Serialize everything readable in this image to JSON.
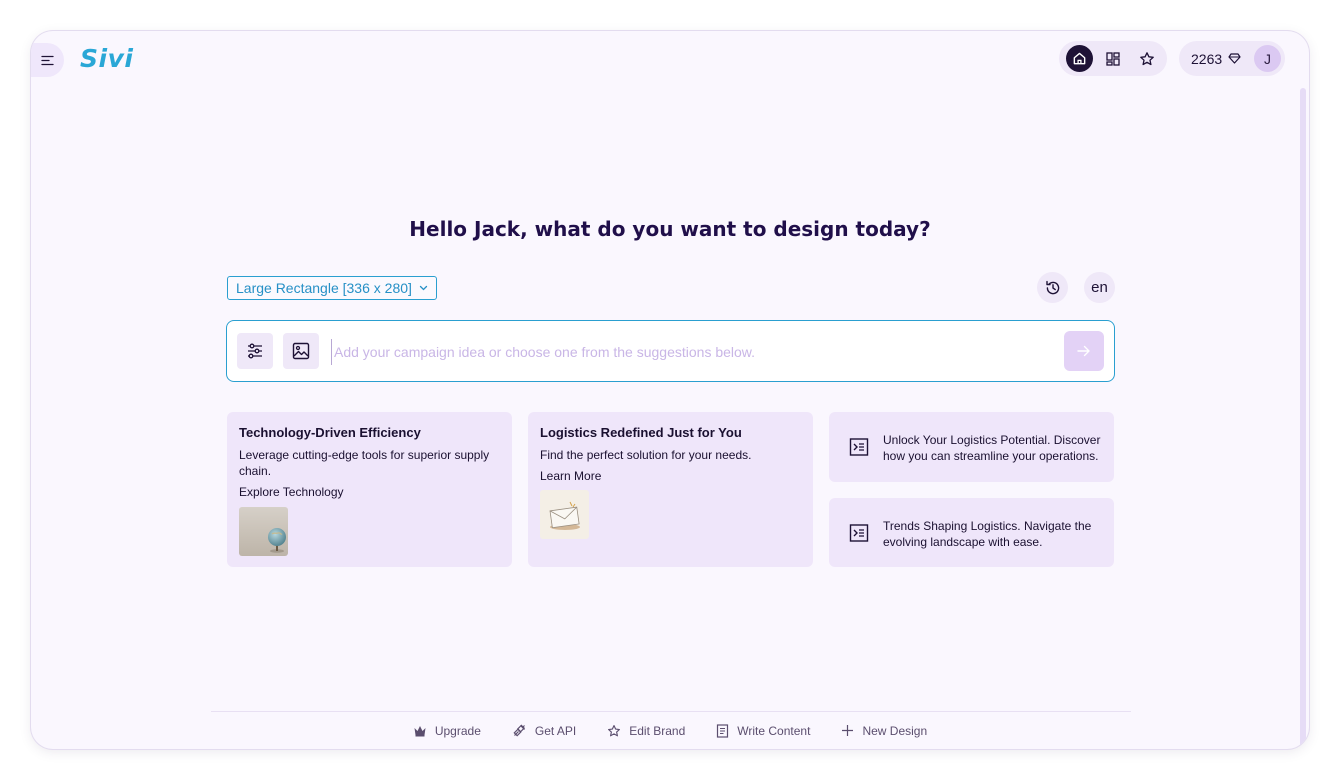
{
  "header": {
    "logo_text": "Sivi",
    "nav_icons": [
      "home-icon",
      "grid-icon",
      "star-icon"
    ],
    "credits": "2263",
    "avatar_initial": "J"
  },
  "main": {
    "greeting": "Hello Jack, what do you want to design today?",
    "size_select": {
      "value": "Large Rectangle [336 x 280]"
    },
    "language": "en",
    "prompt": {
      "placeholder": "Add your campaign idea or choose one from the suggestions below."
    }
  },
  "suggestions": [
    {
      "title": "Technology-Driven Efficiency",
      "description": "Leverage cutting-edge tools for superior supply chain.",
      "cta": "Explore Technology",
      "thumbnail": "globe-image"
    },
    {
      "title": "Logistics Redefined Just for You",
      "description": "Find the perfect solution for your needs.",
      "cta": "Learn More",
      "thumbnail": "envelope-image"
    },
    {
      "text": "Unlock Your Logistics Potential. Discover how you can streamline your operations.",
      "icon": "prompt-icon"
    },
    {
      "text": "Trends Shaping Logistics. Navigate the evolving landscape with ease.",
      "icon": "prompt-icon"
    }
  ],
  "footer": {
    "items": [
      {
        "label": "Upgrade",
        "icon": "crown-icon"
      },
      {
        "label": "Get API",
        "icon": "api-icon"
      },
      {
        "label": "Edit Brand",
        "icon": "star-icon"
      },
      {
        "label": "Write Content",
        "icon": "document-icon"
      },
      {
        "label": "New Design",
        "icon": "plus-icon"
      }
    ]
  },
  "colors": {
    "accent_blue": "#2a9fd0",
    "heading_navy": "#200f4a",
    "card_lavender": "#efe6fa",
    "background": "#faf7fe"
  }
}
